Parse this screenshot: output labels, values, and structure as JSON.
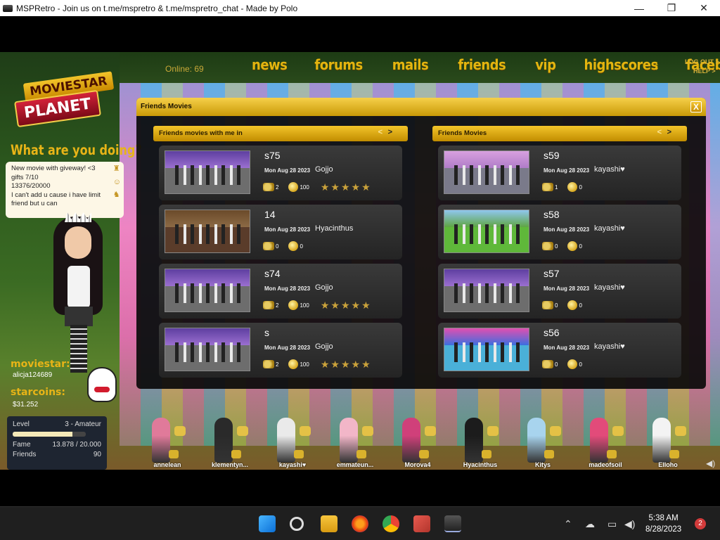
{
  "window": {
    "title": "MSPRetro - Join us on t.me/mspretro & t.me/mspretro_chat - Made by Polo",
    "minimize": "—",
    "maximize": "❐",
    "close": "✕"
  },
  "topbar": {
    "online": "Online: 69",
    "nav": [
      "news",
      "forums",
      "mails",
      "friends",
      "vip",
      "highscores",
      "facebook"
    ],
    "arrows": "↕",
    "logout": "LOG OUT >",
    "help": "HELP >"
  },
  "logo": {
    "line1": "MOVIESTAR",
    "line2": "PLANET"
  },
  "status": {
    "heading": "What are you doing?",
    "text_lines": [
      "New movie with  giveway! <3",
      "gifts 7/10",
      "13376/20000",
      "I can't add u cause i have limit",
      "friend but u can"
    ]
  },
  "profile": {
    "moviestar_label": "moviestar:",
    "username": "alicja124689",
    "starcoins_label": "starcoins:",
    "starcoins": "$31.252",
    "level_label": "Level",
    "level_value": "3 - Amateur",
    "level_progress": 0.82,
    "fame_label": "Fame",
    "fame_value": "13.878 / 20.000",
    "friends_label": "Friends",
    "friends_value": "90"
  },
  "panel": {
    "title": "Friends Movies",
    "close": "X",
    "left": {
      "header": "Friends movies with me in",
      "prev": "<",
      "next": ">",
      "movies": [
        {
          "title": "s75",
          "date": "Mon Aug 28 2023",
          "author": "Gojjo",
          "views": "2",
          "coins": "100",
          "rating": 5
        },
        {
          "title": "14",
          "date": "Mon Aug 28 2023",
          "author": "Hyacinthus",
          "views": "0",
          "coins": "0",
          "rating": 0
        },
        {
          "title": "s74",
          "date": "Mon Aug 28 2023",
          "author": "Gojjo",
          "views": "2",
          "coins": "100",
          "rating": 5
        },
        {
          "title": "s",
          "date": "Mon Aug 28 2023",
          "author": "Gojjo",
          "views": "2",
          "coins": "100",
          "rating": 5
        }
      ]
    },
    "right": {
      "header": "Friends Movies",
      "prev": "<",
      "next": ">",
      "movies": [
        {
          "title": "s59",
          "date": "Mon Aug 28 2023",
          "author": "kayashi♥",
          "views": "1",
          "coins": "0",
          "rating": 0
        },
        {
          "title": "s58",
          "date": "Mon Aug 28 2023",
          "author": "kayashi♥",
          "views": "0",
          "coins": "0",
          "rating": 0
        },
        {
          "title": "s57",
          "date": "Mon Aug 28 2023",
          "author": "kayashi♥",
          "views": "0",
          "coins": "0",
          "rating": 0
        },
        {
          "title": "s56",
          "date": "Mon Aug 28 2023",
          "author": "kayashi♥",
          "views": "0",
          "coins": "0",
          "rating": 0
        }
      ]
    }
  },
  "friends_strip": [
    "annelean",
    "klementyn...",
    "kayashi♥",
    "emmateun...",
    "Morova4",
    "Hyacinthus",
    "Kitys",
    "madeofsoil",
    "Elloho"
  ],
  "taskbar": {
    "time": "5:38 AM",
    "date": "8/28/2023",
    "notifications": "2"
  }
}
